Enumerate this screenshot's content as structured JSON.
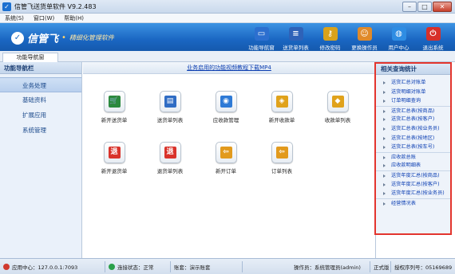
{
  "app": {
    "title": "信管飞送货单软件 V9.2.483",
    "icon": "app-icon"
  },
  "window_buttons": {
    "minimize": "–",
    "maximize": "□",
    "close": "✕"
  },
  "menu": [
    "系统(S)",
    "窗口(W)",
    "帮助(H)"
  ],
  "banner": {
    "brand": "信管飞",
    "slogan": "精细化管理软件"
  },
  "toolbar": [
    {
      "label": "功能导航窗",
      "icon": "monitor-icon",
      "glyph": "▭",
      "color": "#2c6fcf"
    },
    {
      "label": "送货单列表",
      "icon": "list-icon",
      "glyph": "≡",
      "color": "#2e62b8"
    },
    {
      "label": "修改密码",
      "icon": "key-lock-icon",
      "glyph": "⚷",
      "color": "#d9a21b"
    },
    {
      "label": "更换操作员",
      "icon": "user-icon",
      "glyph": "☺",
      "color": "#e08a2a"
    },
    {
      "label": "用户中心",
      "icon": "globe-icon",
      "glyph": "◍",
      "color": "#2f8de3"
    },
    {
      "label": "退出系统",
      "icon": "power-icon",
      "glyph": "⏻",
      "color": "#d7302a"
    }
  ],
  "tab": {
    "label": "功能导航窗"
  },
  "sidebar": {
    "header": "功能导航栏",
    "items": [
      "业务处理",
      "基础资料",
      "扩展应用",
      "系统管理"
    ]
  },
  "main": {
    "banner_link": "业务启用的功能视频教程下载MP4",
    "icons": [
      {
        "label": "新开送货单",
        "icon": "cart-icon",
        "glyph": "🛒",
        "color": "#2b8a3e"
      },
      {
        "label": "送货单列表",
        "icon": "document-list-icon",
        "glyph": "▤",
        "color": "#2f6cc4"
      },
      {
        "label": "应收款管理",
        "icon": "receivable-icon",
        "glyph": "◉",
        "color": "#2e7ad6"
      },
      {
        "label": "新开收款单",
        "icon": "receipt-icon",
        "glyph": "◈",
        "color": "#e0a21b"
      },
      {
        "label": "收款单列表",
        "icon": "receipt-list-icon",
        "glyph": "◆",
        "color": "#e0a21b"
      },
      {
        "label": "新开退货单",
        "icon": "return-icon",
        "glyph": "退",
        "color": "#d9332b"
      },
      {
        "label": "退货单列表",
        "icon": "return-list-icon",
        "glyph": "退",
        "color": "#d9332b"
      },
      {
        "label": "新开订单",
        "icon": "order-icon",
        "glyph": "⇦",
        "color": "#e29a1d"
      },
      {
        "label": "订单列表",
        "icon": "order-list-icon",
        "glyph": "⇦",
        "color": "#e29a1d"
      }
    ]
  },
  "right_panel": {
    "header": "相关查询统计",
    "items": [
      "送货汇总对账单",
      "送货明细对账单",
      "订单明细查询",
      "送货汇总表(按商品)",
      "送货汇总表(按客户)",
      "送货汇总表(按业务员)",
      "送货汇总表(按地区)",
      "送货汇总表(按车号)",
      "应收款总账",
      "应收款明细表",
      "送货年度汇总(按商品)",
      "送货年度汇总(按客户)",
      "送货年度汇总(按业务员)",
      "经营情况表"
    ],
    "separators_before": [
      3,
      8,
      10,
      13
    ]
  },
  "status": {
    "center": "应用中心：127.0.0.1:7093",
    "connection": "连接状态：正常",
    "store": "账套：演示账套",
    "operator": "操作员：系统管理员(admin)",
    "edition": "正式版",
    "serial": "授权序列号：05169689"
  }
}
